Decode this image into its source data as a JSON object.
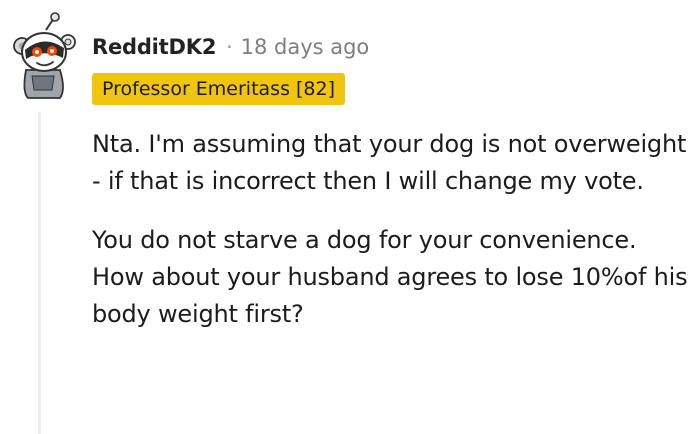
{
  "comment": {
    "username": "RedditDK2",
    "separator": "·",
    "timestamp": "18 days ago",
    "flair": "Professor Emeritass [82]",
    "paragraphs": [
      "Nta. I'm assuming that your dog is not overweight - if that is incorrect then I will change my vote.",
      "You do not starve a dog for your convenience. How about your husband agrees to lose 10%of his body weight first?"
    ]
  },
  "colors": {
    "flair_background": "#f1c40f",
    "username": "#222222",
    "timestamp": "#7c7e80",
    "thread_line": "#ececec",
    "text": "#1c1c1c"
  },
  "icons": {
    "avatar": "snoo-avatar-icon"
  }
}
